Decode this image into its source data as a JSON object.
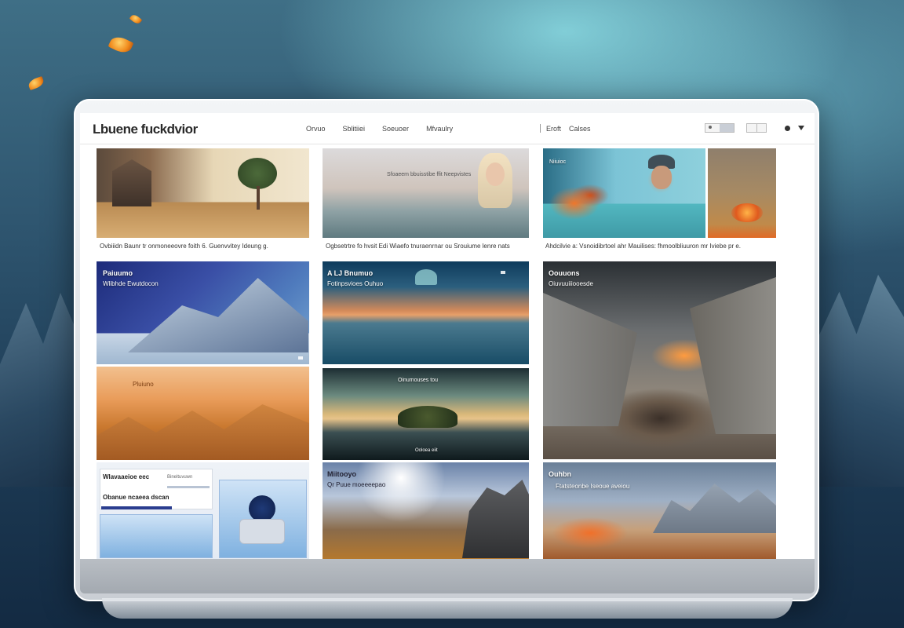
{
  "app": {
    "brand": "Lbuene fuckdvior"
  },
  "nav": {
    "links": [
      "Orvuo",
      "Sblitiiei",
      "Soeuoer",
      "Mfvaulry"
    ],
    "extra": [
      "Eroft",
      "Calses"
    ]
  },
  "cards": [
    {
      "id": "desert",
      "caption": "Ovbiiidn Baunr tr onmoneeovre foith 6. Guenvvitey Ideung g."
    },
    {
      "id": "woman",
      "caption": "Ogbsetrtre fo hvsit Edi Wiaefo tnuraenrnar ou Srouiume lenre nats",
      "overlay": "Sfoaeem bbuisstibe ffit Neepvistes"
    },
    {
      "id": "man",
      "caption": "Ahdcilvie a: Vsnoidibrtoel ahr Mauilises: fhmoolbliuuron mr Iviebe pr e.",
      "overlay": "Niiuioc"
    },
    {
      "id": "blue-mountain",
      "title": "Paiuumo",
      "subtitle": "Wlibhde Ewutdocon"
    },
    {
      "id": "sea-sunset",
      "title": "A LJ Bnumuo",
      "subtitle": "Fotinpsvioes Ouhuo"
    },
    {
      "id": "crater",
      "title": "Oouuons",
      "subtitle": "Oiuvuuiiiooesde"
    },
    {
      "id": "orange-mountain",
      "title": "Pluiuno"
    },
    {
      "id": "island",
      "title": "Oinumouses tou",
      "subtitle": "Ooloea eiit"
    },
    {
      "id": "dashboard",
      "title": "Wlavaaeioe eec",
      "subtitle": "Obanue ncaeea dscan",
      "line": "Bineltuvuwn"
    },
    {
      "id": "sunrise",
      "title": "Miitooyo",
      "subtitle": "Qr Puue moeeeepao"
    },
    {
      "id": "fire-mountain",
      "title": "Ouhbn",
      "subtitle": "Ftatsteonbe Iseoue aveiou"
    }
  ]
}
